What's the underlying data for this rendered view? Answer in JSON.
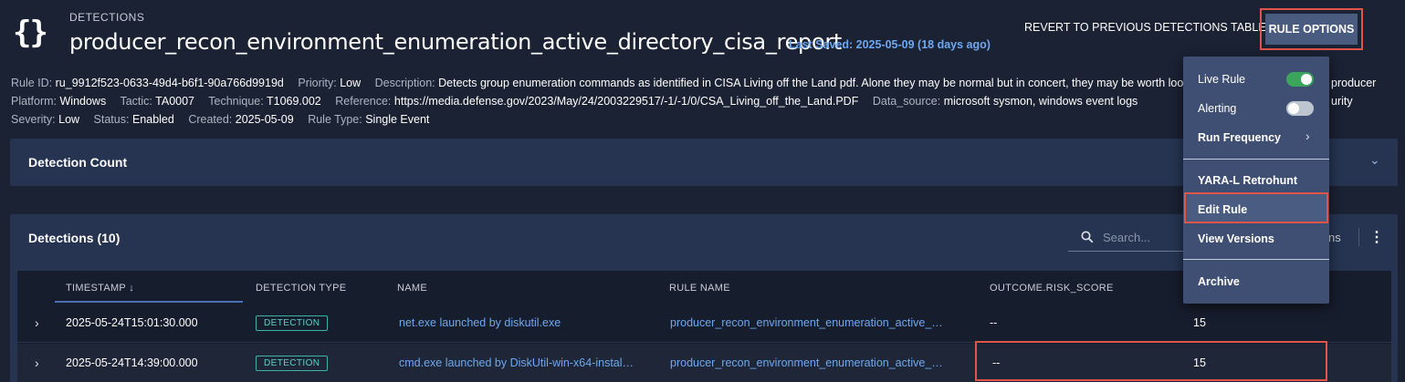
{
  "header": {
    "breadcrumb": "DETECTIONS",
    "rule_name": "producer_recon_environment_enumeration_active_directory_cisa_report",
    "last_saved": "Last Saved: 2025-05-09 (18 days ago)",
    "revert_label": "REVERT TO PREVIOUS DETECTIONS TABLE",
    "rule_options_label": "RULE OPTIONS"
  },
  "meta": {
    "line1": [
      {
        "key": "Rule ID:",
        "value": "ru_9912f523-0633-49d4-b6f1-90a766d9919d"
      },
      {
        "key": "Priority:",
        "value": "Low"
      },
      {
        "key": "Description:",
        "value": "Detects group enumeration commands as identified in CISA Living off the Land pdf. Alone they may be normal but in concert, they may be worth looking into"
      },
      {
        "key": "",
        "value": "producer"
      }
    ],
    "line2": [
      {
        "key": "Platform:",
        "value": "Windows"
      },
      {
        "key": "Tactic:",
        "value": "TA0007"
      },
      {
        "key": "Technique:",
        "value": "T1069.002"
      },
      {
        "key": "Reference:",
        "value": "https://media.defense.gov/2023/May/24/2003229517/-1/-1/0/CSA_Living_off_the_Land.PDF"
      },
      {
        "key": "Data_source:",
        "value": "microsoft sysmon, windows event logs"
      },
      {
        "key": "",
        "value": "urity"
      }
    ],
    "line3": [
      {
        "key": "Severity:",
        "value": "Low"
      },
      {
        "key": "Status:",
        "value": "Enabled"
      },
      {
        "key": "Created:",
        "value": "2025-05-09"
      },
      {
        "key": "Rule Type:",
        "value": "Single Event"
      }
    ]
  },
  "detection_count": {
    "title": "Detection Count"
  },
  "detections": {
    "title": "Detections (10)",
    "search_placeholder": "Search...",
    "columns_partial": "ns",
    "columns": [
      "TIMESTAMP ↓",
      "DETECTION TYPE",
      "NAME",
      "RULE NAME",
      "OUTCOME.RISK_SCORE"
    ],
    "rows": [
      {
        "timestamp": "2025-05-24T15:01:30.000",
        "type": "DETECTION",
        "name": "net.exe launched by diskutil.exe",
        "rule_name": "producer_recon_environment_enumeration_active_…",
        "risk_score": "--",
        "last": "15"
      },
      {
        "timestamp": "2025-05-24T14:39:00.000",
        "type": "DETECTION",
        "name": "cmd.exe launched by DiskUtil-win-x64-instal…",
        "rule_name": "producer_recon_environment_enumeration_active_…",
        "risk_score": "--",
        "last": "15"
      }
    ]
  },
  "menu": {
    "items": [
      {
        "label": "Live Rule",
        "toggle": true
      },
      {
        "label": "Alerting",
        "toggle": false
      },
      {
        "label": "Run Frequency"
      },
      {
        "label": "YARA-L Retrohunt"
      },
      {
        "label": "Edit Rule"
      },
      {
        "label": "View Versions"
      },
      {
        "label": "Archive"
      }
    ]
  },
  "colors": {
    "background": "#1a2233",
    "panel": "#263452",
    "accent_blue": "#6ea8f0",
    "highlight_red": "#e05548",
    "toggle_on": "#3aa55b",
    "toggle_off": "#bfc5cf",
    "badge_teal": "#5fd1c7"
  }
}
